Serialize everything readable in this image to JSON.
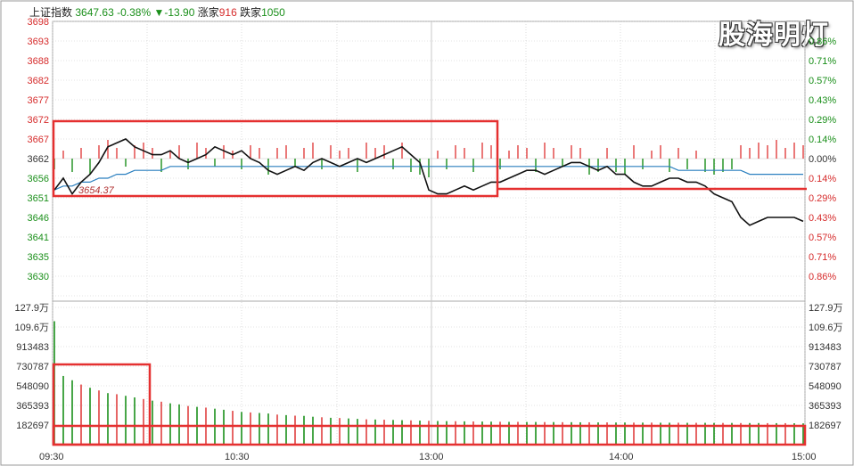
{
  "header": {
    "index_name": "上证指数",
    "price": "3647.63",
    "pct": "-0.38%",
    "change": "▼-13.90",
    "up_label": "涨家",
    "up_count": "916",
    "down_label": "跌家",
    "down_count": "1050"
  },
  "watermark": "股海明灯",
  "colors": {
    "up": "#e04040",
    "down": "#1a8f1a",
    "price_line": "#111111",
    "avg_line": "#2a7fbf",
    "box": "#e53030",
    "grid": "#c8c8c8"
  },
  "chart_data": {
    "type": "line",
    "price_axis_labels": [
      "3698",
      "3693",
      "3688",
      "3682",
      "3677",
      "3672",
      "3667",
      "3662",
      "3656",
      "3651",
      "3646",
      "3641",
      "3635",
      "3630"
    ],
    "pct_axis_labels": [
      "0.86%",
      "0.71%",
      "0.57%",
      "0.43%",
      "0.29%",
      "0.14%",
      "0.00%",
      "0.14%",
      "0.29%",
      "0.43%",
      "0.57%",
      "0.71%",
      "0.86%"
    ],
    "pct_axis_colors": [
      "up",
      "up",
      "up",
      "up",
      "up",
      "up",
      "neutral",
      "down",
      "down",
      "down",
      "down",
      "down",
      "down"
    ],
    "volume_axis_labels": [
      "127.9万",
      "109.6万",
      "913483",
      "730787",
      "548090",
      "365393",
      "182697"
    ],
    "time_labels": [
      "09:30",
      "10:30",
      "13:00",
      "14:00",
      "15:00"
    ],
    "annotation": "3654.37",
    "price_range": [
      3628,
      3698
    ],
    "volume_range": [
      0,
      1279000
    ],
    "price": [
      3655,
      3658,
      3654,
      3657,
      3659,
      3662,
      3666,
      3667,
      3668,
      3666,
      3665,
      3664,
      3664,
      3665,
      3663,
      3662,
      3663,
      3664,
      3666,
      3665,
      3664,
      3665,
      3663,
      3662,
      3660,
      3659,
      3660,
      3661,
      3660,
      3662,
      3663,
      3662,
      3661,
      3662,
      3663,
      3662,
      3663,
      3664,
      3665,
      3666,
      3664,
      3662,
      3655,
      3654,
      3654,
      3655,
      3656,
      3655,
      3656,
      3657,
      3657,
      3658,
      3659,
      3660,
      3660,
      3659,
      3660,
      3661,
      3662,
      3662,
      3661,
      3660,
      3661,
      3659,
      3659,
      3657,
      3656,
      3656,
      3657,
      3658,
      3658,
      3657,
      3657,
      3656,
      3654,
      3653,
      3652,
      3648,
      3646,
      3647,
      3648,
      3648,
      3648,
      3648,
      3647
    ],
    "avg": [
      3655,
      3656,
      3656,
      3657,
      3657,
      3658,
      3658,
      3659,
      3659,
      3660,
      3660,
      3660,
      3660,
      3661,
      3661,
      3661,
      3661,
      3661,
      3661,
      3661,
      3661,
      3661,
      3661,
      3661,
      3661,
      3661,
      3661,
      3661,
      3661,
      3661,
      3661,
      3661,
      3661,
      3661,
      3661,
      3661,
      3661,
      3661,
      3661,
      3661,
      3661,
      3661,
      3661,
      3661,
      3661,
      3661,
      3661,
      3661,
      3661,
      3661,
      3661,
      3661,
      3661,
      3661,
      3661,
      3661,
      3661,
      3661,
      3661,
      3661,
      3661,
      3661,
      3661,
      3661,
      3661,
      3661,
      3661,
      3661,
      3661,
      3661,
      3660,
      3660,
      3660,
      3660,
      3660,
      3660,
      3660,
      3660,
      3659,
      3659,
      3659,
      3659,
      3659,
      3659,
      3659
    ],
    "momentum": [
      -4,
      3,
      -5,
      4,
      -6,
      5,
      7,
      4,
      -3,
      5,
      6,
      4,
      -5,
      3,
      5,
      -4,
      6,
      4,
      -3,
      5,
      3,
      -4,
      5,
      4,
      -6,
      4,
      5,
      -3,
      4,
      6,
      -4,
      5,
      3,
      4,
      -5,
      6,
      4,
      5,
      -4,
      6,
      -5,
      -6,
      -7,
      3,
      -4,
      5,
      4,
      -5,
      6,
      5,
      -4,
      3,
      5,
      4,
      -5,
      6,
      4,
      -3,
      5,
      4,
      -6,
      -5,
      4,
      -5,
      -6,
      5,
      -4,
      3,
      5,
      -5,
      4,
      -4,
      3,
      -5,
      -6,
      -5,
      -4,
      5,
      4,
      6,
      5,
      7,
      4,
      6,
      5
    ],
    "volume": [
      1150000,
      640000,
      600000,
      560000,
      530000,
      505000,
      480000,
      470000,
      455000,
      440000,
      425000,
      410000,
      400000,
      385000,
      375000,
      360000,
      352000,
      345000,
      335000,
      325000,
      315000,
      305000,
      300000,
      295000,
      290000,
      280000,
      275000,
      270000,
      268000,
      260000,
      255000,
      250000,
      248000,
      244000,
      240000,
      236000,
      234000,
      232000,
      230000,
      228000,
      226000,
      224000,
      222000,
      220000,
      219000,
      218000,
      217000,
      216000,
      215000,
      214000,
      213000,
      212000,
      212000,
      211000,
      211000,
      210000,
      210000,
      209000,
      209000,
      208000,
      208000,
      207000,
      207000,
      206000,
      206000,
      205000,
      205000,
      205000,
      204000,
      204000,
      204000,
      203000,
      203000,
      203000,
      202000,
      202000,
      202000,
      201000,
      201000,
      201000,
      200000,
      200000,
      200000,
      199000,
      198000
    ],
    "volume_dir": [
      "down",
      "down",
      "down",
      "up",
      "down",
      "up",
      "down",
      "up",
      "down",
      "down",
      "up",
      "down",
      "up",
      "down",
      "down",
      "up",
      "down",
      "up",
      "down",
      "down",
      "up",
      "down",
      "up",
      "down",
      "down",
      "up",
      "down",
      "up",
      "down",
      "down",
      "up",
      "down",
      "up",
      "down",
      "down",
      "up",
      "down",
      "up",
      "down",
      "down",
      "up",
      "down",
      "up",
      "down",
      "down",
      "up",
      "down",
      "up",
      "down",
      "down",
      "up",
      "down",
      "up",
      "down",
      "down",
      "up",
      "down",
      "up",
      "down",
      "down",
      "up",
      "down",
      "up",
      "down",
      "down",
      "up",
      "down",
      "up",
      "down",
      "down",
      "up",
      "down",
      "up",
      "down",
      "down",
      "up",
      "down",
      "up",
      "down",
      "down",
      "up",
      "down",
      "up",
      "down",
      "down"
    ]
  }
}
